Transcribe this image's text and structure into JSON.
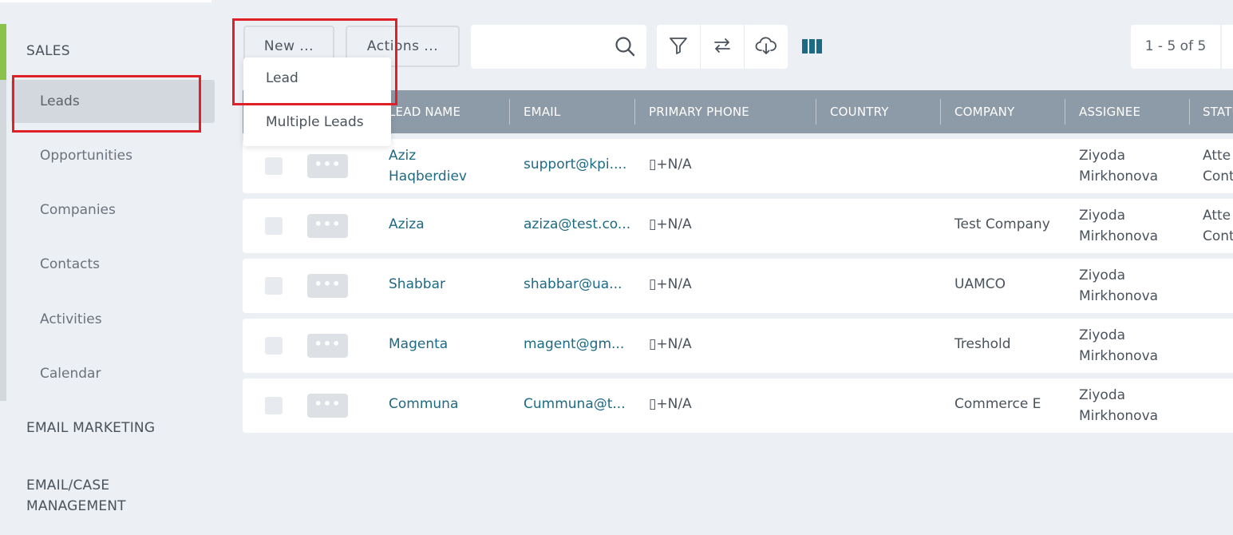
{
  "sidebar": {
    "sections": {
      "sales": "SALES",
      "email_marketing": "EMAIL MARKETING",
      "email_case_line1": "EMAIL/CASE",
      "email_case_line2": "MANAGEMENT"
    },
    "items": [
      {
        "label": "Leads",
        "active": true
      },
      {
        "label": "Opportunities"
      },
      {
        "label": "Companies"
      },
      {
        "label": "Contacts"
      },
      {
        "label": "Activities"
      },
      {
        "label": "Calendar"
      }
    ]
  },
  "toolbar": {
    "new_label": "New ...",
    "actions_label": "Actions ...",
    "search_value": "",
    "icons": [
      "filter-icon",
      "swap-icon",
      "cloud-download-icon",
      "columns-icon"
    ],
    "pager": "1 - 5 of 5"
  },
  "new_menu": {
    "items": [
      "Lead",
      "Multiple Leads"
    ]
  },
  "table": {
    "columns": [
      "LEAD NAME",
      "EMAIL",
      "PRIMARY PHONE",
      "COUNTRY",
      "COMPANY",
      "ASSIGNEE",
      "STATU"
    ],
    "rows": [
      {
        "name1": "Aziz",
        "name2": "Haqberdiev",
        "email": "support@kpi....",
        "phone": "▯+N/A",
        "country": "",
        "company": "",
        "assignee1": "Ziyoda",
        "assignee2": "Mirkhonova",
        "status1": "Atte",
        "status2": "Cont"
      },
      {
        "name1": "Aziza",
        "name2": "",
        "email": "aziza@test.co...",
        "phone": "▯+N/A",
        "country": "",
        "company": "Test Company",
        "assignee1": "Ziyoda",
        "assignee2": "Mirkhonova",
        "status1": "Atte",
        "status2": "Cont"
      },
      {
        "name1": "Shabbar",
        "name2": "",
        "email": "shabbar@ua...",
        "phone": "▯+N/A",
        "country": "",
        "company": "UAMCO",
        "assignee1": "Ziyoda",
        "assignee2": "Mirkhonova",
        "status1": "",
        "status2": ""
      },
      {
        "name1": "Magenta",
        "name2": "",
        "email": "magent@gm...",
        "phone": "▯+N/A",
        "country": "",
        "company": "Treshold",
        "assignee1": "Ziyoda",
        "assignee2": "Mirkhonova",
        "status1": "",
        "status2": ""
      },
      {
        "name1": "Communa",
        "name2": "",
        "email": "Cummuna@t...",
        "phone": "▯+N/A",
        "country": "",
        "company": "Commerce E",
        "assignee1": "Ziyoda",
        "assignee2": "Mirkhonova",
        "status1": "",
        "status2": ""
      }
    ]
  },
  "colors": {
    "accent_green": "#8bc34a",
    "header_bg": "#8d9aa7",
    "link": "#1d6a85",
    "highlight": "#e02027"
  }
}
